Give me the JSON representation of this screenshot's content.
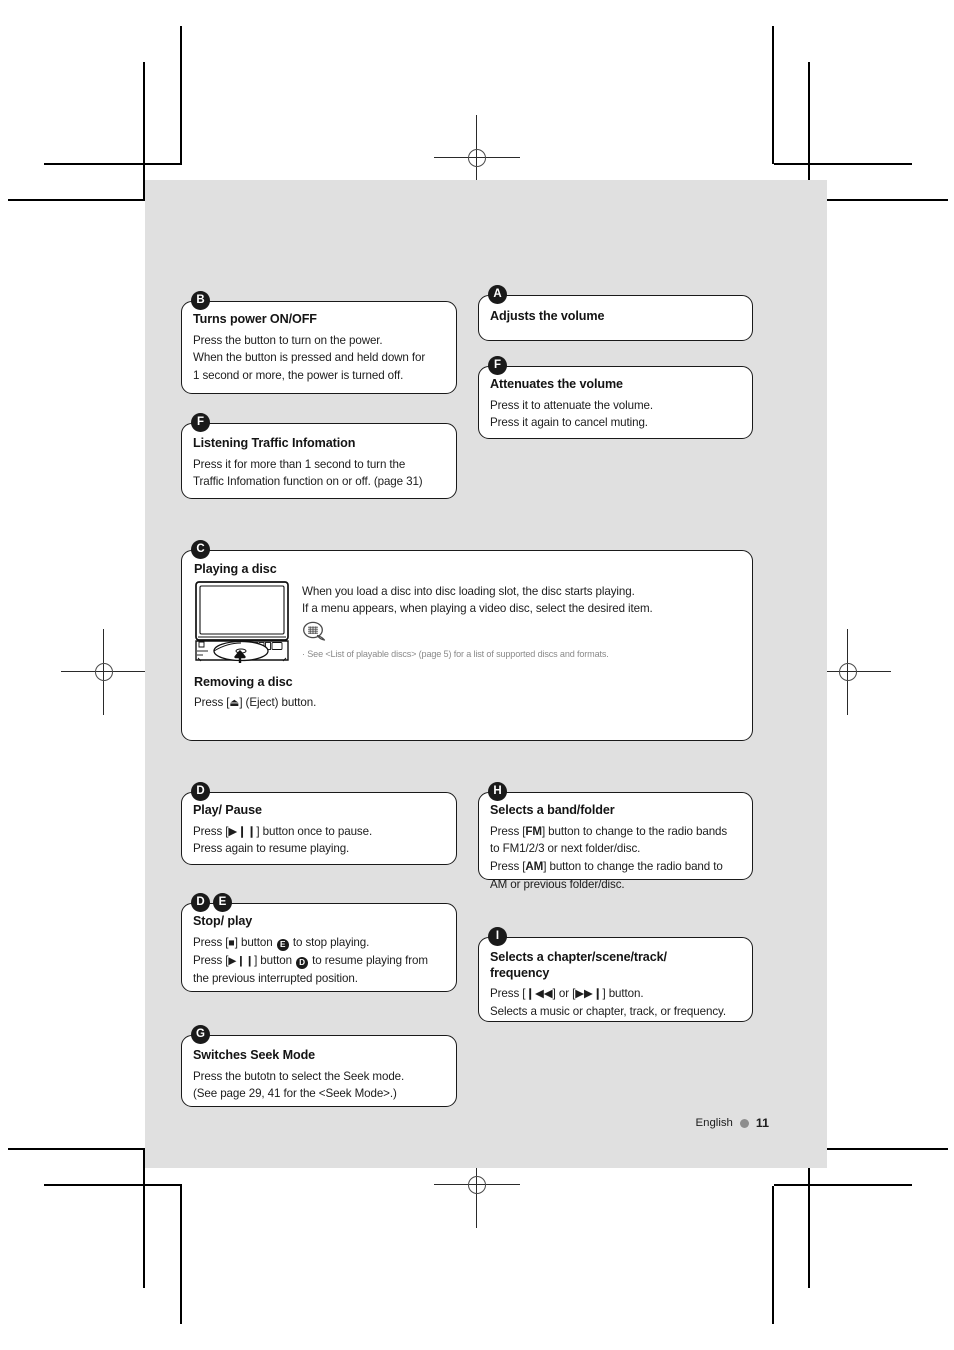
{
  "page": {
    "footer_language": "English",
    "footer_page_number": "11",
    "sheet_color": "#e0e0e0",
    "badge_color": "#1a1a1a",
    "note_color": "#8a8a8a"
  },
  "callouts": [
    {
      "id": "b-power",
      "badges": [
        "B"
      ],
      "title": "Turns power ON/OFF",
      "lines": [
        "Press the button to turn on the power.",
        "When the button is pressed and held down for",
        "1 second or more, the power is turned off."
      ]
    },
    {
      "id": "f-traffic",
      "badges": [
        "F"
      ],
      "title": "Listening Traffic Infomation",
      "lines": [
        "Press it for more than 1 second to turn the",
        "Traffic Infomation function on or off. (page 31)"
      ]
    },
    {
      "id": "a-volume",
      "badges": [
        "A"
      ],
      "title": "Adjusts the volume",
      "lines": []
    },
    {
      "id": "f-attenuate",
      "badges": [
        "F"
      ],
      "title": "Attenuates the volume",
      "lines": [
        "Press it to attenuate the volume.",
        "Press it again to cancel muting."
      ]
    },
    {
      "id": "d-playpause",
      "badges": [
        "D"
      ],
      "title": "Play/ Pause",
      "lines": [
        "Press [▶❙❙] button once to pause.",
        "Press again to resume playing."
      ]
    },
    {
      "id": "de-stopplay",
      "badges": [
        "D",
        "E"
      ],
      "title": "Stop/ play",
      "lines": []
    },
    {
      "id": "g-seek",
      "badges": [
        "G"
      ],
      "title": "Switches Seek Mode",
      "lines": [
        "Press the butotn to select the Seek mode.",
        "(See page 29, 41 for the <Seek Mode>.)"
      ]
    },
    {
      "id": "h-band",
      "badges": [
        "H"
      ],
      "title": "Selects a band/folder",
      "lines": [
        "Press [FM] button to change to the radio bands",
        "to FM1/2/3 or next folder/disc.",
        "Press [AM] button to change the radio band to",
        "AM or previous folder/disc."
      ]
    },
    {
      "id": "i-chapter",
      "badges": [
        "I"
      ],
      "title": "Selects a chapter/scene/track/",
      "title2": "frequency",
      "lines": [
        "Press [❙◀◀] or [▶▶❙] button.",
        "Selects a music or chapter, track, or frequency."
      ]
    }
  ],
  "stop_play": {
    "line1_a": "Press [",
    "line1_sym": "■",
    "line1_b": "] button ",
    "line1_badge": "E",
    "line1_c": " to stop playing.",
    "line2_a": "Press [",
    "line2_sym": "▶❙❙",
    "line2_b": "] button ",
    "line2_badge": "D",
    "line2_c": " to resume playing from",
    "line3": "the previous interrupted position."
  },
  "band_folder": {
    "l1_a": "Press [",
    "l1_key": "FM",
    "l1_b": "] button to change to the radio bands",
    "l2": "to FM1/2/3 or next folder/disc.",
    "l3_a": "Press [",
    "l3_key": "AM",
    "l3_b": "] button to change the radio band to",
    "l4": "AM or previous folder/disc."
  },
  "playing_disc": {
    "badges": [
      "C"
    ],
    "title": "Playing a disc",
    "line1": "When you load a disc into disc loading slot, the disc starts playing.",
    "line2": "If a menu appears, when playing a video disc, select the desired item.",
    "note": "· See <List of playable discs> (page 5) for a list of supported discs and formats.",
    "subtitle": "Removing a disc",
    "subline_a": "Press [",
    "subline_sym": "⏏",
    "subline_b": "] (Eject) button."
  }
}
